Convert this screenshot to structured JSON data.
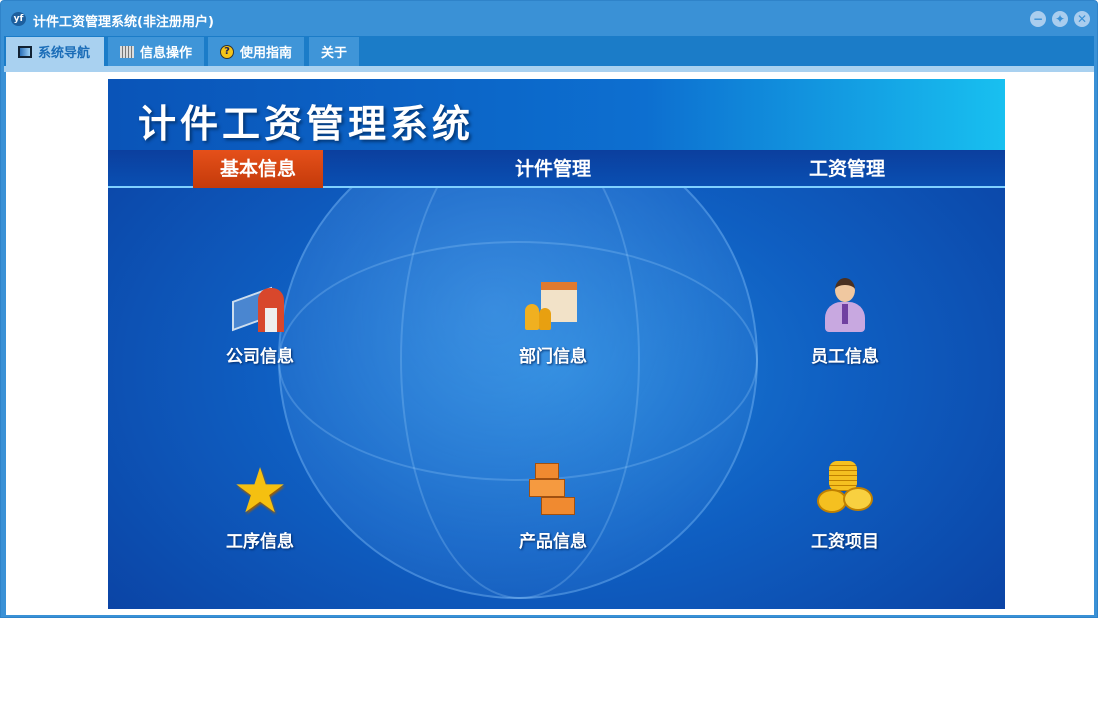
{
  "window": {
    "title": "计件工资管理系统(非注册用户)",
    "logo": "yf"
  },
  "tabs": [
    {
      "label": "系统导航",
      "icon": "monitor-icon"
    },
    {
      "label": "信息操作",
      "icon": "grid-icon"
    },
    {
      "label": "使用指南",
      "icon": "help-icon"
    },
    {
      "label": "关于"
    }
  ],
  "banner": {
    "title": "计件工资管理系统",
    "nav": [
      {
        "label": "基本信息",
        "active": true
      },
      {
        "label": "计件管理"
      },
      {
        "label": "工资管理"
      }
    ],
    "tiles": [
      {
        "label": "公司信息",
        "icon": "building-book-icon"
      },
      {
        "label": "部门信息",
        "icon": "department-icon"
      },
      {
        "label": "员工信息",
        "icon": "employee-icon"
      },
      {
        "label": "工序信息",
        "icon": "star-icon"
      },
      {
        "label": "产品信息",
        "icon": "boxes-icon"
      },
      {
        "label": "工资项目",
        "icon": "coins-icon"
      }
    ]
  },
  "colors": {
    "accent": "#e5501a",
    "titlebar": "#3a91d6"
  }
}
